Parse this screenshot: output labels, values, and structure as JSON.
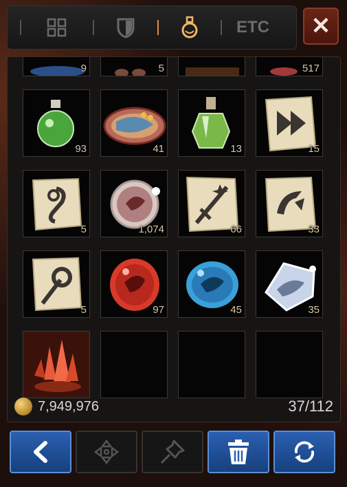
{
  "tabs": [
    {
      "name": "all",
      "icon": "grid-icon"
    },
    {
      "name": "equipment",
      "icon": "shield-icon"
    },
    {
      "name": "consumables",
      "icon": "potion-icon",
      "active": true
    },
    {
      "name": "etc",
      "label": "ETC"
    }
  ],
  "close_label": "✕",
  "partial_row_quantities": [
    "9",
    "5",
    "",
    "517"
  ],
  "slots": [
    {
      "icon": "green-potion-icon",
      "qty": "93"
    },
    {
      "icon": "fish-dish-icon",
      "qty": "41"
    },
    {
      "icon": "green-elixir-icon",
      "qty": "13"
    },
    {
      "icon": "double-arrow-scroll-icon",
      "qty": "15"
    },
    {
      "icon": "hook-scroll-icon",
      "qty": "5"
    },
    {
      "icon": "dragon-orb-icon",
      "qty": "1,074"
    },
    {
      "icon": "sword-scroll-icon",
      "qty": "66"
    },
    {
      "icon": "curve-scroll-icon",
      "qty": "33"
    },
    {
      "icon": "arrow-scroll-icon",
      "qty": "5"
    },
    {
      "icon": "red-dragon-stone-icon",
      "qty": "97"
    },
    {
      "icon": "blue-dragon-stone-icon",
      "qty": "45"
    },
    {
      "icon": "white-dragon-gem-icon",
      "qty": "35"
    },
    {
      "icon": "red-crystal-icon",
      "qty": ""
    },
    {
      "icon": "empty",
      "qty": ""
    },
    {
      "icon": "empty",
      "qty": ""
    },
    {
      "icon": "empty",
      "qty": ""
    }
  ],
  "gold": "7,949,976",
  "capacity": "37/112",
  "buttons": [
    {
      "name": "back",
      "icon": "chevron-left-icon"
    },
    {
      "name": "move",
      "icon": "move-icon"
    },
    {
      "name": "pin",
      "icon": "pin-icon"
    },
    {
      "name": "discard",
      "icon": "trash-icon"
    },
    {
      "name": "sort",
      "icon": "refresh-icon"
    }
  ]
}
